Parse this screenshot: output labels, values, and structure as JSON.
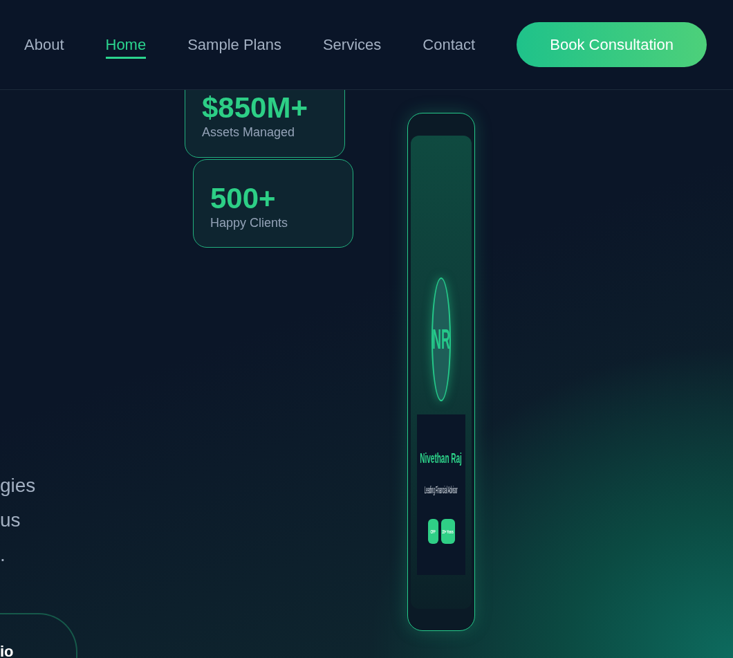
{
  "nav": {
    "links": [
      {
        "label": "About",
        "selected": false
      },
      {
        "label": "Home",
        "selected": true
      },
      {
        "label": "Sample Plans",
        "selected": false
      },
      {
        "label": "Services",
        "selected": false
      },
      {
        "label": "Contact",
        "selected": false
      }
    ],
    "cta": "Book Consultation"
  },
  "hero": {
    "lines": [
      "gies",
      "us",
      "."
    ],
    "button": "io"
  },
  "stats": [
    {
      "value": "$850M+",
      "label": "Assets Managed"
    },
    {
      "value": "500+",
      "label": "Happy Clients"
    }
  ],
  "profile": {
    "initials": "NR",
    "name": "Nivethan Raj",
    "title": "Leading Financial Advisor",
    "badges": [
      "CFP",
      "15+ Years"
    ]
  }
}
